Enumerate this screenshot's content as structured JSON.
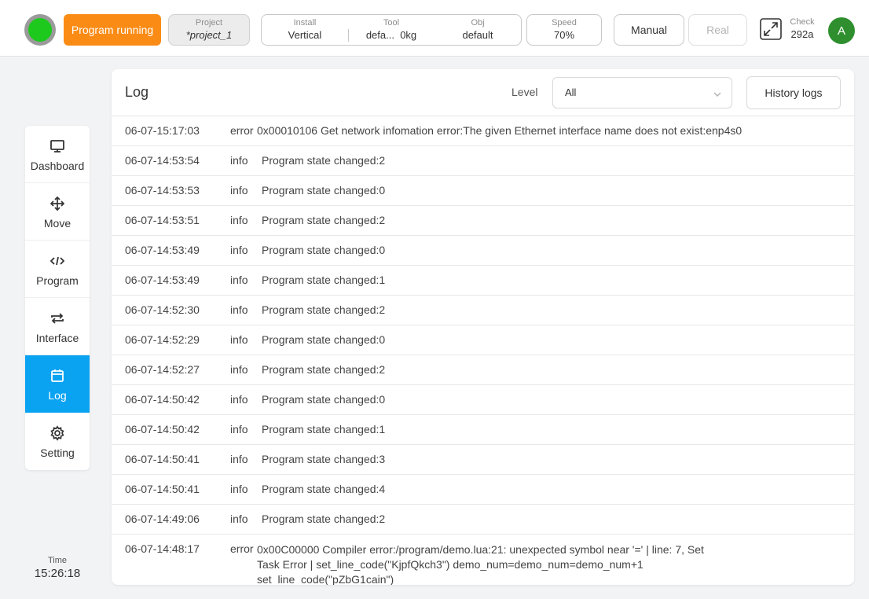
{
  "topbar": {
    "status_button": "Program running",
    "project": {
      "label": "Project",
      "value": "*project_1"
    },
    "install": {
      "label": "Install",
      "value": "Vertical"
    },
    "tool": {
      "label": "Tool",
      "value": "defa...",
      "weight": "0kg"
    },
    "obj": {
      "label": "Obj",
      "value": "default"
    },
    "speed": {
      "label": "Speed",
      "value": "70%"
    },
    "manual_button": "Manual",
    "real_button": "Real",
    "check": {
      "label": "Check",
      "value": "292a"
    },
    "avatar_letter": "A",
    "colors": {
      "running": "#fa8c16",
      "status_light": "#1ec91e",
      "avatar": "#2f8f2f",
      "active_nav": "#0aa3f2"
    }
  },
  "sidebar": {
    "items": [
      {
        "label": "Dashboard",
        "icon": "monitor-icon"
      },
      {
        "label": "Move",
        "icon": "move-arrows-icon"
      },
      {
        "label": "Program",
        "icon": "code-icon"
      },
      {
        "label": "Interface",
        "icon": "swap-arrows-icon"
      },
      {
        "label": "Log",
        "icon": "calendar-icon",
        "active": true
      },
      {
        "label": "Setting",
        "icon": "gear-icon"
      }
    ],
    "time": {
      "label": "Time",
      "value": "15:26:18"
    }
  },
  "log": {
    "title": "Log",
    "level_label": "Level",
    "level_value": "All",
    "history_button": "History logs",
    "rows": [
      {
        "time": "06-07-15:17:03",
        "level": "error",
        "message": "0x00010106 Get network infomation error:The given Ethernet interface name does not exist:enp4s0"
      },
      {
        "time": "06-07-14:53:54",
        "level": "info",
        "message": "Program state changed:2"
      },
      {
        "time": "06-07-14:53:53",
        "level": "info",
        "message": "Program state changed:0"
      },
      {
        "time": "06-07-14:53:51",
        "level": "info",
        "message": "Program state changed:2"
      },
      {
        "time": "06-07-14:53:49",
        "level": "info",
        "message": "Program state changed:0"
      },
      {
        "time": "06-07-14:53:49",
        "level": "info",
        "message": "Program state changed:1"
      },
      {
        "time": "06-07-14:52:30",
        "level": "info",
        "message": "Program state changed:2"
      },
      {
        "time": "06-07-14:52:29",
        "level": "info",
        "message": "Program state changed:0"
      },
      {
        "time": "06-07-14:52:27",
        "level": "info",
        "message": "Program state changed:2"
      },
      {
        "time": "06-07-14:50:42",
        "level": "info",
        "message": "Program state changed:0"
      },
      {
        "time": "06-07-14:50:42",
        "level": "info",
        "message": "Program state changed:1"
      },
      {
        "time": "06-07-14:50:41",
        "level": "info",
        "message": "Program state changed:3"
      },
      {
        "time": "06-07-14:50:41",
        "level": "info",
        "message": "Program state changed:4"
      },
      {
        "time": "06-07-14:49:06",
        "level": "info",
        "message": "Program state changed:2"
      },
      {
        "time": "06-07-14:48:17",
        "level": "error",
        "message": "0x00C00000 Compiler error:/program/demo.lua:21: unexpected symbol near '=' | line: 7, Set Task Error | set_line_code(\"KjpfQkch3\") demo_num=demo_num=demo_num+1 set_line_code(\"pZbG1cain\")"
      }
    ]
  }
}
